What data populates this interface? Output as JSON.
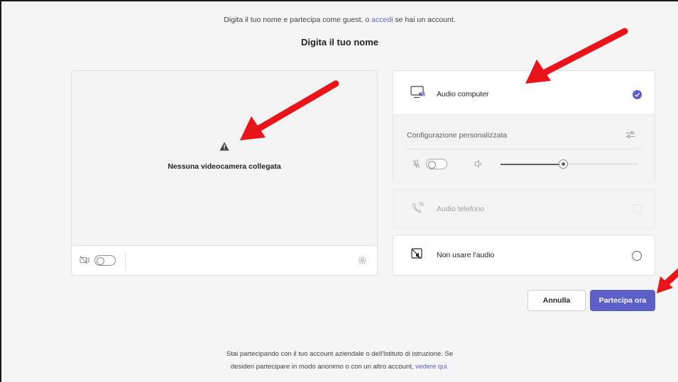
{
  "header": {
    "hint_prefix": "Digita il tuo nome e partecipa come guest, o",
    "hint_link": "accedi",
    "hint_suffix": "se hai un account.",
    "title": "Digita il tuo nome"
  },
  "video": {
    "status_text": "Nessuna videocamera collegata",
    "camera_on": false
  },
  "audio_options": {
    "computer": {
      "label": "Audio computer",
      "selected": true,
      "custom_config_label": "Configurazione personalizzata",
      "mic_on": false,
      "volume_percent": 46
    },
    "phone": {
      "label": "Audio telefono",
      "disabled": true
    },
    "none": {
      "label": "Non usare l'audio",
      "selected": false
    }
  },
  "actions": {
    "cancel_label": "Annulla",
    "join_label": "Partecipa ora"
  },
  "footer": {
    "line1": "Stai partecipando con il tuo account aziendale o dell'Istituto di istruzione. Se",
    "line2_prefix": "desideri partecipare in modo anonimo o con un altro account,",
    "line2_link": "vedere qui."
  },
  "colors": {
    "accent": "#5b5fc7",
    "annotation_arrow": "#e8141a",
    "background": "#f5f5f5"
  },
  "annotations": {
    "arrow_count": 3
  }
}
